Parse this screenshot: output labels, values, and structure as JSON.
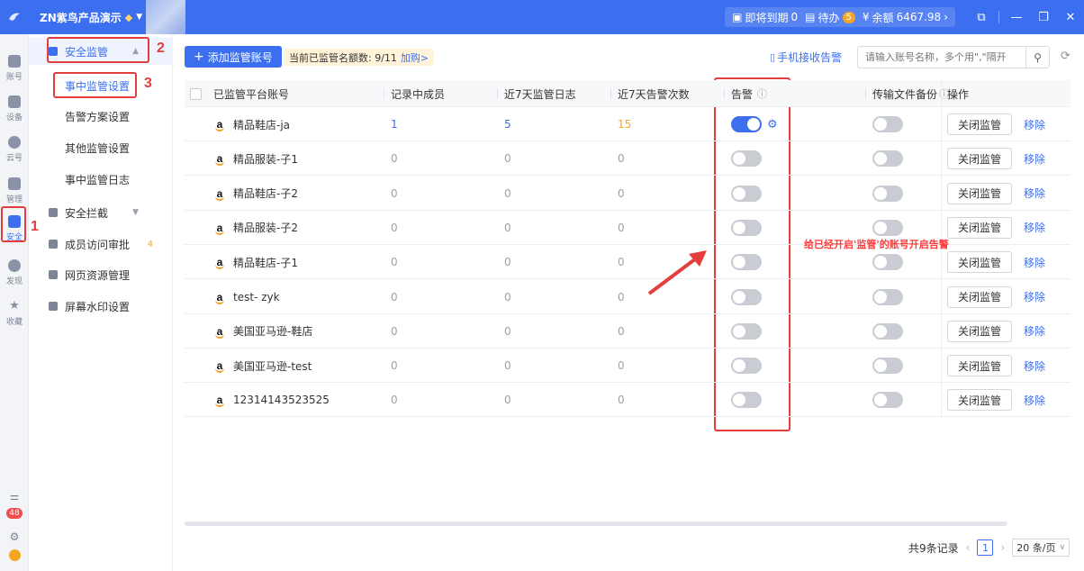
{
  "topbar": {
    "title": "ZN紫鸟产品演示",
    "expiring_label": "即将到期",
    "expiring_count": "0",
    "todo_label": "待办",
    "todo_count": "5",
    "balance_label": "余额",
    "balance_value": "6467.98"
  },
  "rail": {
    "items": [
      {
        "label": "账号"
      },
      {
        "label": "设备"
      },
      {
        "label": "云号"
      },
      {
        "label": "管理"
      },
      {
        "label": "安全"
      },
      {
        "label": "发现"
      },
      {
        "label": "收藏"
      }
    ],
    "msg_count": "48"
  },
  "submenu": {
    "group_security": "安全监管",
    "items": [
      "事中监管设置",
      "告警方案设置",
      "其他监管设置",
      "事中监管日志"
    ],
    "intercept": "安全拦截",
    "member_access": "成员访问审批",
    "member_access_count": "4",
    "web_resources": "网页资源管理",
    "watermark": "屏幕水印设置"
  },
  "annotations": {
    "n1": "1",
    "n2": "2",
    "n3": "3",
    "note": "给已经开启'监管'的账号开启告警"
  },
  "toolbar": {
    "add_label": "添加监管账号",
    "quota_label": "当前已监管名额数: 9/11",
    "quota_link": "加购>",
    "phone_alert": "手机接收告警",
    "search_placeholder": "请输入账号名称，多个用\",\"隔开"
  },
  "table": {
    "headers": {
      "account": "已监管平台账号",
      "members": "记录中成员",
      "logs": "近7天监管日志",
      "alerts": "近7天告警次数",
      "alarm": "告警",
      "backup": "传输文件备份",
      "ops": "操作"
    },
    "close_label": "关闭监管",
    "remove_label": "移除",
    "rows": [
      {
        "name": "精品鞋店-ja",
        "members": "1",
        "logs": "5",
        "alerts": "15",
        "alarm_on": true
      },
      {
        "name": "精品服装-子1",
        "members": "0",
        "logs": "0",
        "alerts": "0",
        "alarm_on": false
      },
      {
        "name": "精品鞋店-子2",
        "members": "0",
        "logs": "0",
        "alerts": "0",
        "alarm_on": false
      },
      {
        "name": "精品服装-子2",
        "members": "0",
        "logs": "0",
        "alerts": "0",
        "alarm_on": false
      },
      {
        "name": "精品鞋店-子1",
        "members": "0",
        "logs": "0",
        "alerts": "0",
        "alarm_on": false
      },
      {
        "name": "test- zyk",
        "members": "0",
        "logs": "0",
        "alerts": "0",
        "alarm_on": false
      },
      {
        "name": "美国亚马逊-鞋店",
        "members": "0",
        "logs": "0",
        "alerts": "0",
        "alarm_on": false
      },
      {
        "name": "美国亚马逊-test",
        "members": "0",
        "logs": "0",
        "alerts": "0",
        "alarm_on": false
      },
      {
        "name": "12314143523525",
        "members": "0",
        "logs": "0",
        "alerts": "0",
        "alarm_on": false
      }
    ]
  },
  "pager": {
    "total": "共9条记录",
    "page": "1",
    "per_page": "20 条/页"
  },
  "colors": {
    "brand": "#3b6ff0",
    "annotation": "#e43d3d"
  }
}
